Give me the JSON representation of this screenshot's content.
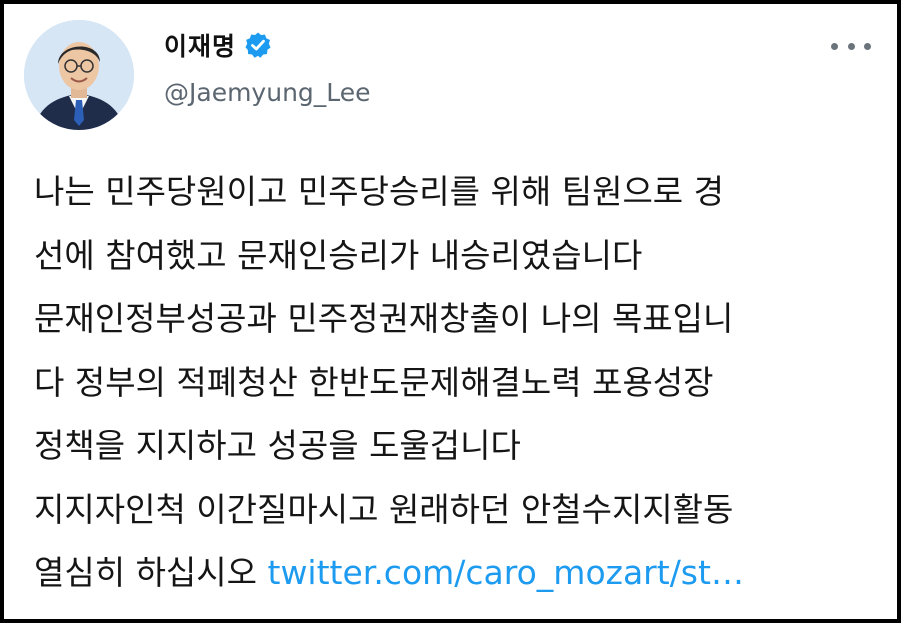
{
  "tweet": {
    "author": {
      "display_name": "이재명",
      "handle": "@Jaemyung_Lee",
      "verified": true,
      "verified_icon": "verified-badge-icon",
      "verified_color": "#1d9bf0"
    },
    "more_icon": "more-horizontal-icon",
    "lines": [
      "나는 민주당원이고 민주당승리를 위해 팀원으로 경",
      "선에 참여했고 문재인승리가 내승리였습니다",
      "문재인정부성공과 민주정권재창출이 나의 목표입니",
      "다 정부의 적폐청산 한반도문제해결노력 포용성장",
      "정책을 지지하고 성공을 도울겁니다",
      "지지자인척 이간질마시고 원래하던 안철수지지활동"
    ],
    "last_line_text": "열심히 하십시오 ",
    "link_text": "twitter.com/caro_mozart/st…",
    "link_color": "#1d9bf0"
  }
}
